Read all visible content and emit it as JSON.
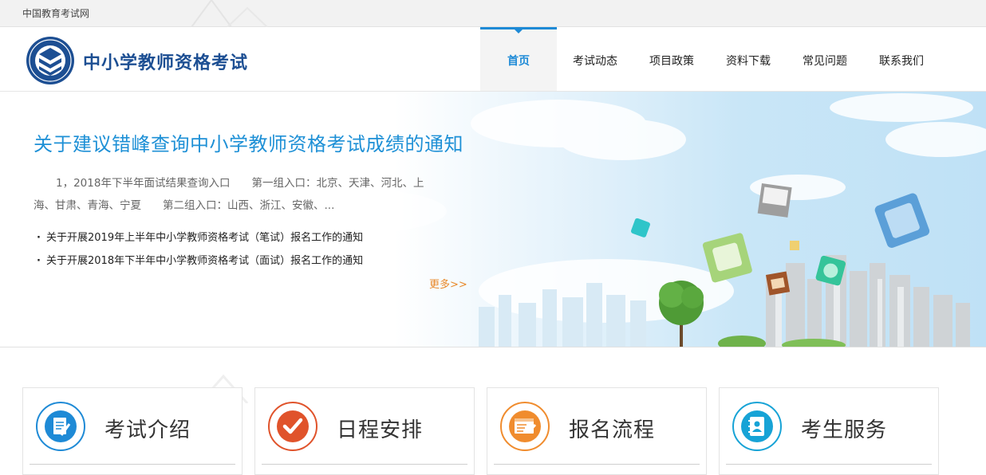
{
  "topbar": {
    "site_link": "中国教育考试网"
  },
  "header": {
    "logo_icon": "exam-center-seal-icon",
    "site_title": "中小学教师资格考试",
    "nav": [
      {
        "label": "首页",
        "active": true
      },
      {
        "label": "考试动态",
        "active": false
      },
      {
        "label": "项目政策",
        "active": false
      },
      {
        "label": "资料下载",
        "active": false
      },
      {
        "label": "常见问题",
        "active": false
      },
      {
        "label": "联系我们",
        "active": false
      }
    ]
  },
  "banner": {
    "headline": "关于建议错峰查询中小学教师资格考试成绩的通知",
    "summary_line1": "1，2018年下半年面试结果查询入口　　第一组入口：北京、天津、河北、上",
    "summary_line2": "海、甘肃、青海、宁夏　　第二组入口：山西、浙江、安徽、...",
    "news": [
      {
        "bullet": "·",
        "title": "关于开展2019年上半年中小学教师资格考试（笔试）报名工作的通知"
      },
      {
        "bullet": "·",
        "title": "关于开展2018年下半年中小学教师资格考试（面试）报名工作的通知"
      }
    ],
    "more_link": "更多>>"
  },
  "cards": [
    {
      "label": "考试介绍",
      "icon": "document-edit-icon",
      "color": "#1e8ad6"
    },
    {
      "label": "日程安排",
      "icon": "checkmark-icon",
      "color": "#e0532b"
    },
    {
      "label": "报名流程",
      "icon": "form-edit-icon",
      "color": "#f08c2e"
    },
    {
      "label": "考生服务",
      "icon": "contact-book-icon",
      "color": "#17a3d6"
    }
  ],
  "colors": {
    "accent_blue": "#1e8ad6",
    "title_blue": "#1d4f93",
    "more_orange": "#e8892a"
  }
}
